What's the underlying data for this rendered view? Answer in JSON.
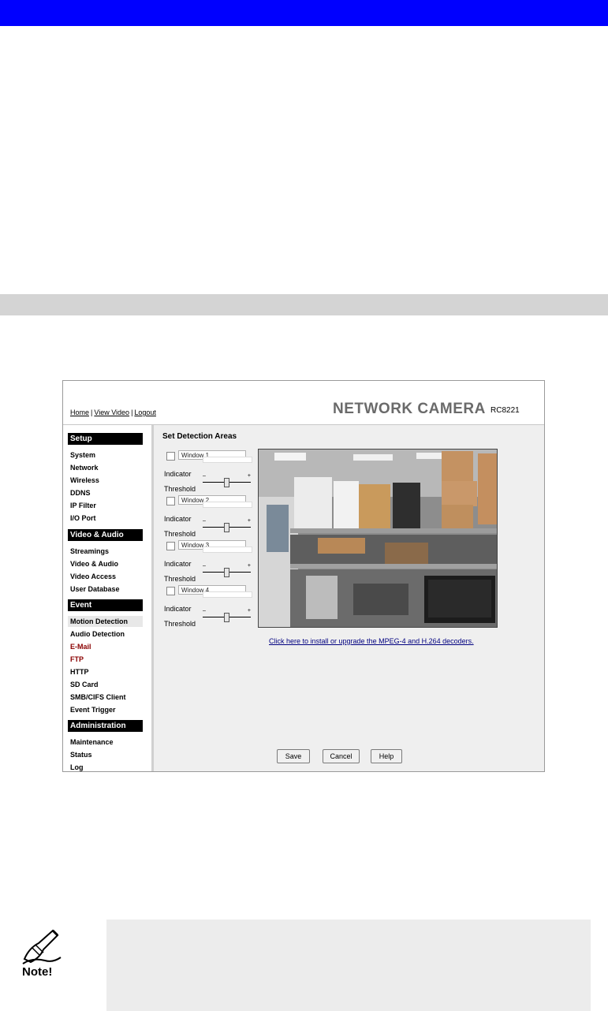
{
  "header": {
    "links": [
      "Home",
      "View Video",
      "Logout"
    ],
    "brand": "NETWORK CAMERA",
    "model": "RC8221"
  },
  "sidebar": {
    "sections": [
      {
        "title": "Setup",
        "items": [
          "System",
          "Network",
          "Wireless",
          "DDNS",
          "IP Filter",
          "I/O Port"
        ]
      },
      {
        "title": "Video & Audio",
        "items": [
          "Streamings",
          "Video & Audio",
          "Video Access",
          "User Database"
        ]
      },
      {
        "title": "Event",
        "items": [
          "Motion Detection",
          "Audio Detection",
          "E-Mail",
          "FTP",
          "HTTP",
          "SD Card",
          "SMB/CIFS Client",
          "Event Trigger"
        ]
      },
      {
        "title": "Administration",
        "items": [
          "Maintenance",
          "Status",
          "Log"
        ]
      }
    ],
    "active_item": "Motion Detection"
  },
  "main": {
    "title": "Set Detection Areas",
    "indicator_label": "Indicator",
    "threshold_label": "Threshold",
    "slider_minus": "–",
    "slider_plus": "+",
    "windows": [
      {
        "name": "Window 1",
        "checked": false,
        "threshold": 0.5
      },
      {
        "name": "Window 2",
        "checked": false,
        "threshold": 0.5
      },
      {
        "name": "Window 3",
        "checked": false,
        "threshold": 0.5
      },
      {
        "name": "Window 4",
        "checked": false,
        "threshold": 0.5
      }
    ],
    "decoder_link": "Click here to install or upgrade the MPEG-4 and H.264 decoders."
  },
  "buttons": {
    "save": "Save",
    "cancel": "Cancel",
    "help": "Help"
  },
  "note": {
    "icon_label": "Note!"
  },
  "colors": {
    "top_bar": "#0000ff",
    "gray_bar": "#d4d4d4",
    "note_bg": "#ececec"
  }
}
